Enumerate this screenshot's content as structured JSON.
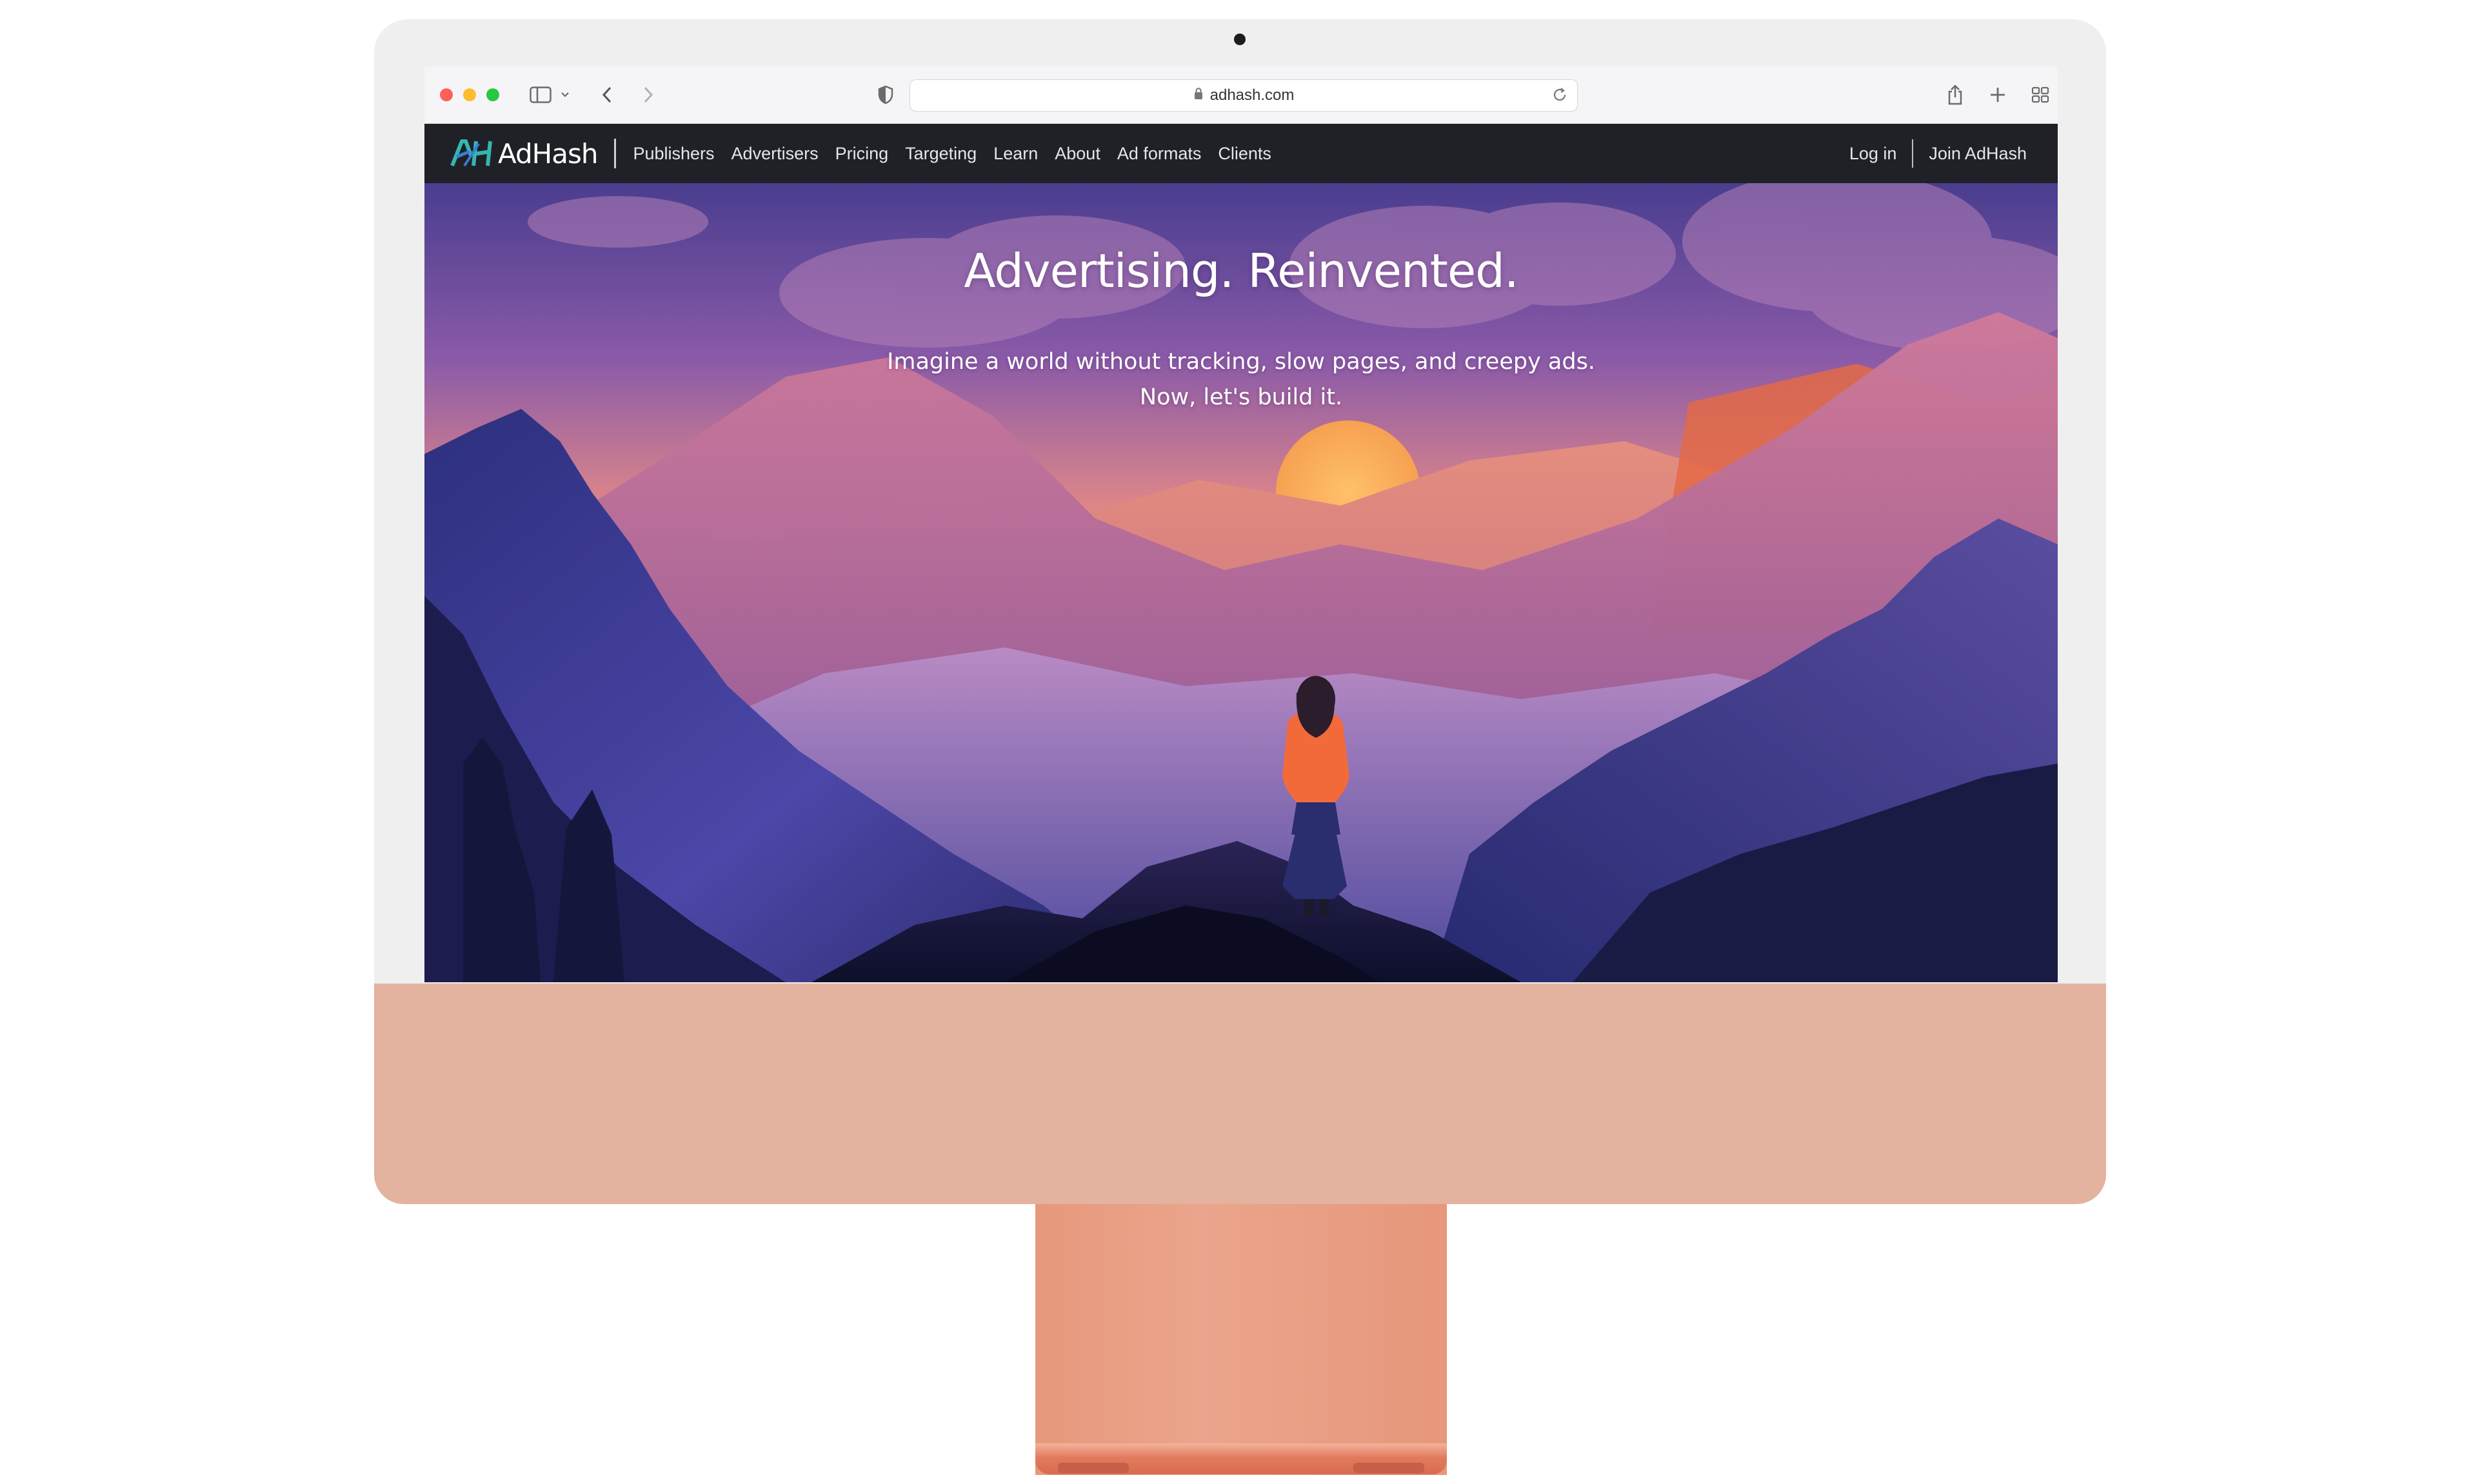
{
  "browser": {
    "url": "adhash.com"
  },
  "site": {
    "logo_text": "AdHash",
    "nav": [
      {
        "label": "Publishers"
      },
      {
        "label": "Advertisers"
      },
      {
        "label": "Pricing"
      },
      {
        "label": "Targeting"
      },
      {
        "label": "Learn"
      },
      {
        "label": "About"
      },
      {
        "label": "Ad formats"
      },
      {
        "label": "Clients"
      }
    ],
    "login_label": "Log in",
    "join_label": "Join AdHash"
  },
  "hero": {
    "title": "Advertising. Reinvented.",
    "subtitle_line1": "Imagine a world without tracking, slow pages, and creepy ads.",
    "subtitle_line2": "Now, let's build it."
  },
  "colors": {
    "nav_bg": "#1f2126",
    "chin": "#e3b3a0",
    "stand": "#e7987c",
    "logo_teal": "#36b5b0",
    "logo_blue": "#3a7bd5"
  },
  "icons": [
    "sidebar-icon",
    "chevron-down-icon",
    "back-icon",
    "forward-icon",
    "shield-icon",
    "lock-icon",
    "reload-icon",
    "share-icon",
    "new-tab-icon",
    "tab-overview-icon"
  ]
}
